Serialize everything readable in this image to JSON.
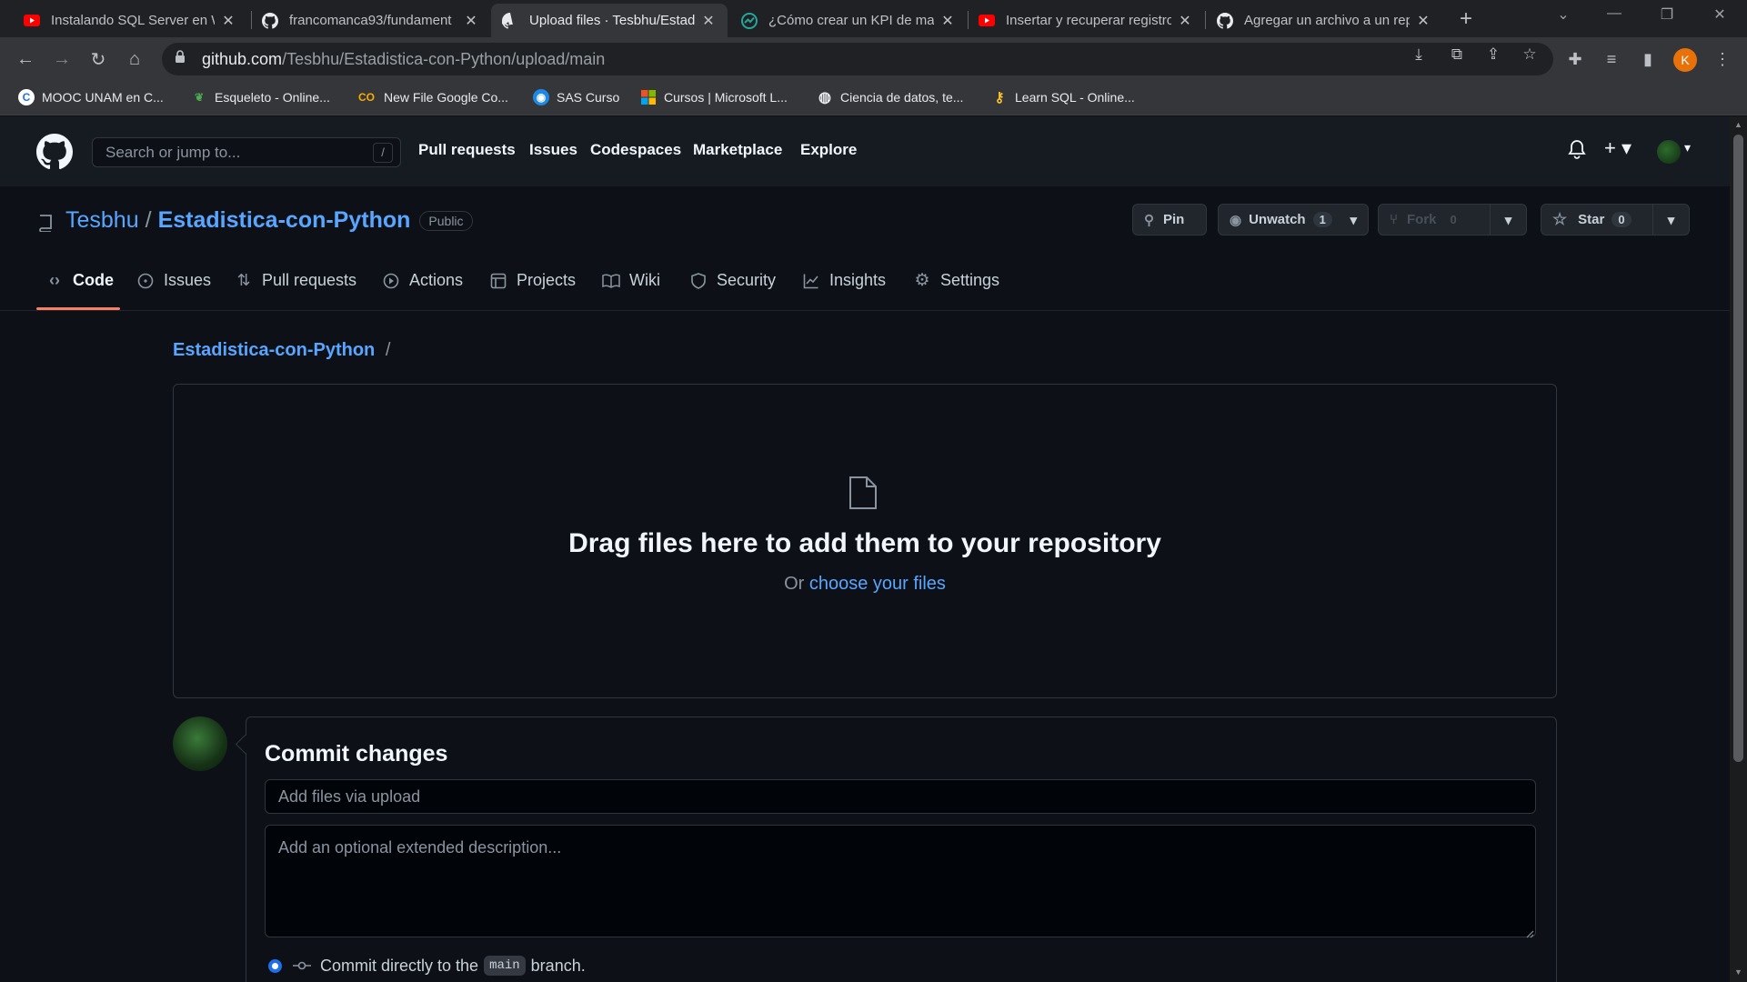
{
  "browser": {
    "tabs": [
      {
        "title": "Instalando SQL Server en W",
        "favicon": "youtube-icon",
        "active": false
      },
      {
        "title": "francomanca93/fundament",
        "favicon": "github-icon",
        "active": false
      },
      {
        "title": "Upload files · Tesbhu/Estadi",
        "favicon": "github-icon",
        "active": true
      },
      {
        "title": "¿Cómo crear un KPI de mar",
        "favicon": "chart-icon",
        "active": false
      },
      {
        "title": "Insertar y recuperar registro",
        "favicon": "youtube-icon",
        "active": false
      },
      {
        "title": "Agregar un archivo a un rep",
        "favicon": "github-icon",
        "active": false
      }
    ],
    "url_host": "github.com",
    "url_path": "/Tesbhu/Estadistica-con-Python/upload/main",
    "profile_initial": "K",
    "bookmarks": [
      {
        "label": "MOOC UNAM en C...",
        "icon": "c-icon",
        "color": "#1a73e8"
      },
      {
        "label": "Esqueleto - Online...",
        "icon": "leaf-icon",
        "color": "#4caf50"
      },
      {
        "label": "New File Google Co...",
        "icon": "colab-icon",
        "color": "#f9ab00"
      },
      {
        "label": "SAS Curso",
        "icon": "sas-icon",
        "color": "#1e88e5"
      },
      {
        "label": "Cursos | Microsoft L...",
        "icon": "microsoft-icon",
        "color": "#f25022"
      },
      {
        "label": "Ciencia de datos, te...",
        "icon": "globe-icon",
        "color": "#e8eaed"
      },
      {
        "label": "Learn SQL - Online...",
        "icon": "key-icon",
        "color": "#fbc02d"
      }
    ]
  },
  "github": {
    "search_placeholder": "Search or jump to...",
    "search_shortcut": "/",
    "nav": [
      "Pull requests",
      "Issues",
      "Codespaces",
      "Marketplace",
      "Explore"
    ]
  },
  "repo": {
    "owner": "Tesbhu",
    "separator": "/",
    "name": "Estadistica-con-Python",
    "visibility": "Public",
    "pin_label": "Pin",
    "unwatch_label": "Unwatch",
    "watch_count": "1",
    "fork_label": "Fork",
    "fork_count": "0",
    "star_label": "Star",
    "star_count": "0",
    "tabs": [
      "Code",
      "Issues",
      "Pull requests",
      "Actions",
      "Projects",
      "Wiki",
      "Security",
      "Insights",
      "Settings"
    ]
  },
  "upload": {
    "breadcrumb_repo": "Estadistica-con-Python",
    "breadcrumb_sep": "/",
    "drop_title": "Drag files here to add them to your repository",
    "drop_or": "Or",
    "choose_files": "choose your files"
  },
  "commit": {
    "title": "Commit changes",
    "summary_placeholder": "Add files via upload",
    "description_placeholder": "Add an optional extended description...",
    "option_prefix": "Commit directly to the",
    "branch": "main",
    "option_suffix": "branch."
  },
  "colors": {
    "accent_link": "#58a6ff",
    "tab_underline": "#f78166",
    "background": "#0d1117"
  }
}
